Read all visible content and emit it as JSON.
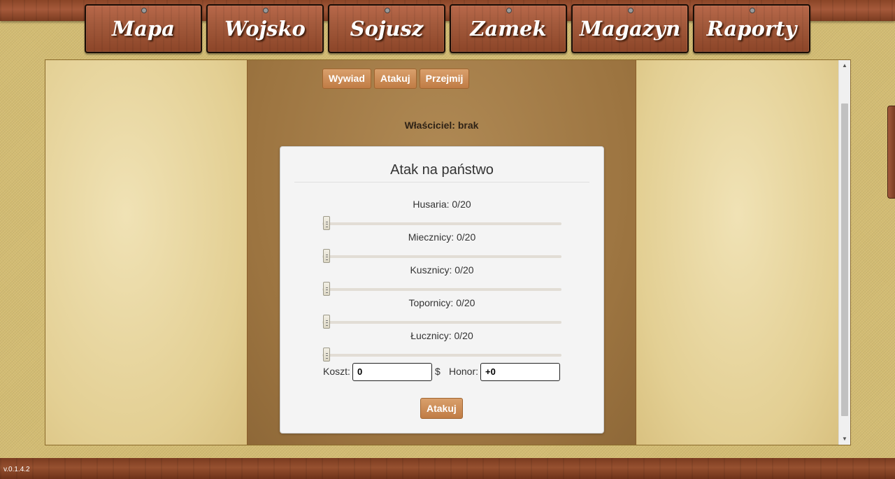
{
  "nav": {
    "items": [
      {
        "label": "Mapa"
      },
      {
        "label": "Wojsko"
      },
      {
        "label": "Sojusz"
      },
      {
        "label": "Zamek"
      },
      {
        "label": "Magazyn"
      },
      {
        "label": "Raporty"
      }
    ]
  },
  "actions": {
    "wywiad": "Wywiad",
    "atakuj": "Atakuj",
    "przejmij": "Przejmij"
  },
  "owner": "Właściciel: brak",
  "dialog": {
    "title": "Atak na państwo",
    "units": [
      {
        "label": "Husaria:",
        "count": "0/20",
        "value": 0
      },
      {
        "label": "Miecznicy:",
        "count": "0/20",
        "value": 0
      },
      {
        "label": "Kusznicy:",
        "count": "0/20",
        "value": 0
      },
      {
        "label": "Topornicy:",
        "count": "0/20",
        "value": 0
      },
      {
        "label": "Łucznicy:",
        "count": "0/20",
        "value": 0
      }
    ],
    "cost_label": "Koszt:",
    "cost_value": "0",
    "currency": "$",
    "honor_label": "Honor:",
    "honor_value": "+0",
    "submit": "Atakuj"
  },
  "version": "v.0.1.4.2",
  "colors": {
    "wood": "#a35a3c",
    "button": "#c07c45",
    "parchment": "#e3cf93"
  }
}
